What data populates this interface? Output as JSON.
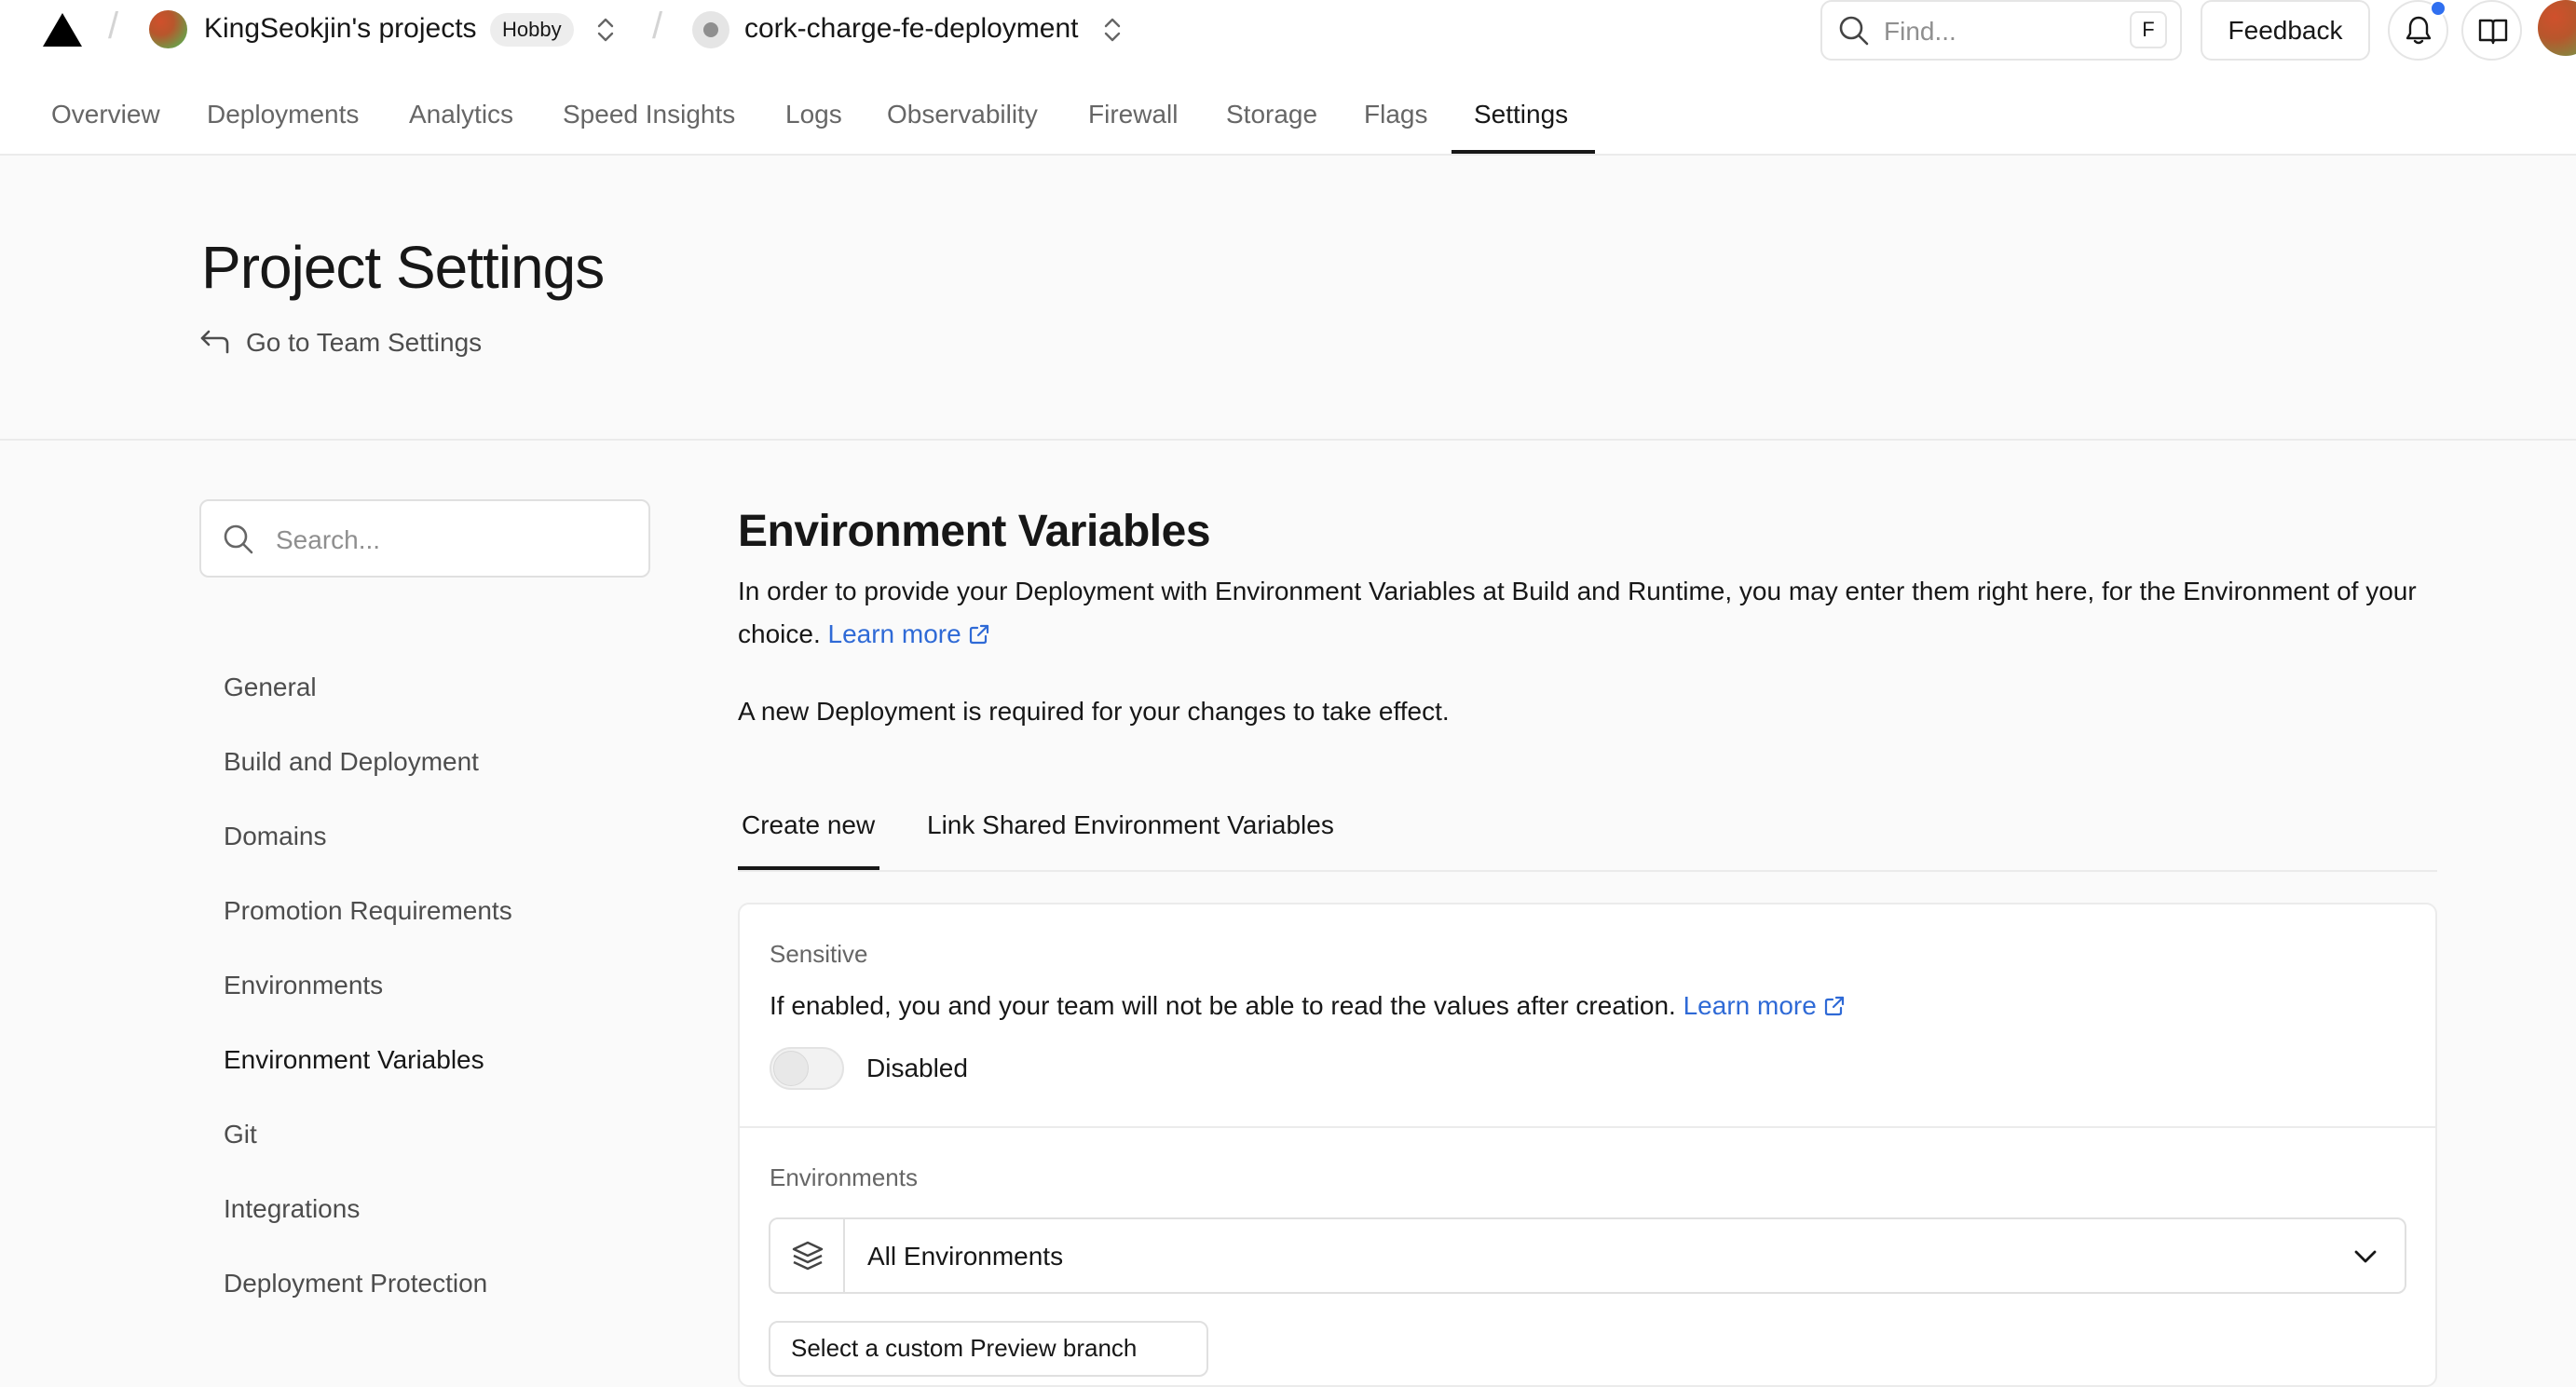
{
  "header": {
    "team_name": "KingSeokjin's projects",
    "plan_badge": "Hobby",
    "project_name": "cork-charge-fe-deployment",
    "find_placeholder": "Find...",
    "find_shortcut": "F",
    "feedback_label": "Feedback"
  },
  "nav": {
    "tabs": [
      {
        "label": "Overview"
      },
      {
        "label": "Deployments"
      },
      {
        "label": "Analytics"
      },
      {
        "label": "Speed Insights"
      },
      {
        "label": "Logs"
      },
      {
        "label": "Observability"
      },
      {
        "label": "Firewall"
      },
      {
        "label": "Storage"
      },
      {
        "label": "Flags"
      },
      {
        "label": "Settings"
      }
    ],
    "active": "Settings"
  },
  "page": {
    "title": "Project Settings",
    "back_link": "Go to Team Settings"
  },
  "sidebar": {
    "search_placeholder": "Search...",
    "items": [
      {
        "label": "General"
      },
      {
        "label": "Build and Deployment"
      },
      {
        "label": "Domains"
      },
      {
        "label": "Promotion Requirements"
      },
      {
        "label": "Environments"
      },
      {
        "label": "Environment Variables"
      },
      {
        "label": "Git"
      },
      {
        "label": "Integrations"
      },
      {
        "label": "Deployment Protection"
      }
    ],
    "active": "Environment Variables"
  },
  "main": {
    "title": "Environment Variables",
    "description": "In order to provide your Deployment with Environment Variables at Build and Runtime, you may enter them right here, for the Environment of your choice.",
    "learn_more": "Learn more",
    "notice": "A new Deployment is required for your changes to take effect.",
    "tabs": [
      {
        "label": "Create new"
      },
      {
        "label": "Link Shared Environment Variables"
      }
    ],
    "active_tab": "Create new",
    "sensitive": {
      "label": "Sensitive",
      "text": "If enabled, you and your team will not be able to read the values after creation.",
      "learn_more": "Learn more",
      "toggle_state": "Disabled"
    },
    "environments": {
      "label": "Environments",
      "selected": "All Environments"
    },
    "partial_button_label": "Select a custom Preview branch"
  },
  "colors": {
    "link": "#2f6ad6",
    "notification_dot": "#2f6ff0",
    "text": "#171717",
    "muted": "#666666"
  }
}
